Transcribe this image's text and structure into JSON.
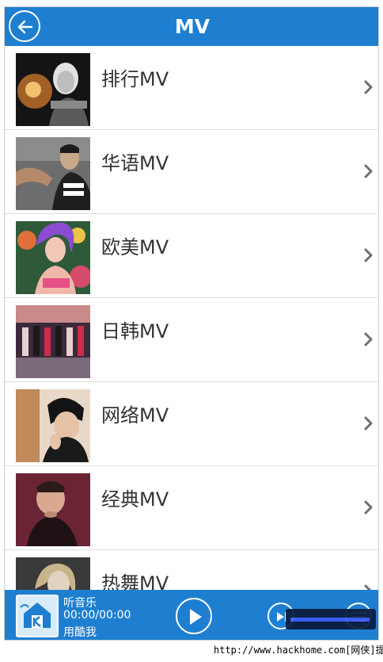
{
  "header": {
    "title": "MV"
  },
  "mv_categories": [
    {
      "label": "排行MV"
    },
    {
      "label": "华语MV"
    },
    {
      "label": "欧美MV"
    },
    {
      "label": "日韩MV"
    },
    {
      "label": "网络MV"
    },
    {
      "label": "经典MV"
    },
    {
      "label": "热舞MV"
    }
  ],
  "player": {
    "title": "听音乐",
    "time": "00:00/00:00",
    "artist": "用酷我"
  },
  "footer": {
    "credit": "http://www.hackhome.com[网侠]提供"
  },
  "colors": {
    "accent": "#1e7fd0",
    "text": "#333333",
    "divider": "#dedede"
  },
  "icons": {
    "back": "arrow-left-icon",
    "chevron": "chevron-right-icon",
    "play": "play-icon",
    "next": "skip-next-icon",
    "playlist": "playlist-icon"
  }
}
